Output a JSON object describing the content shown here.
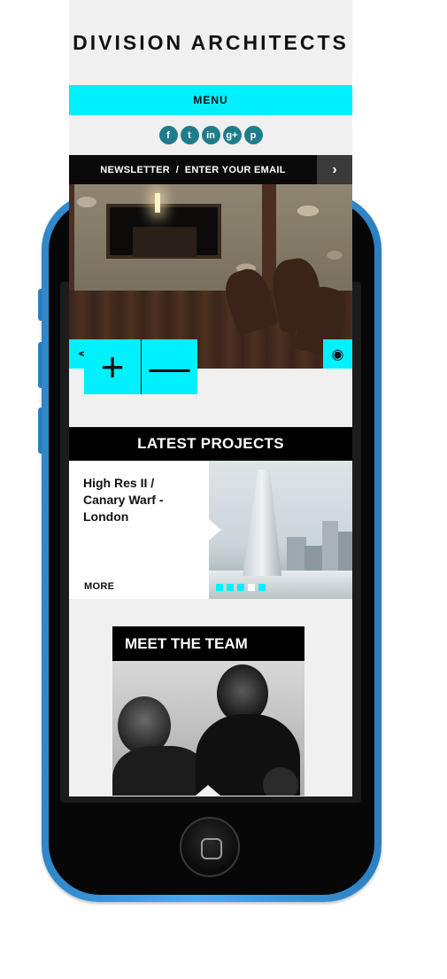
{
  "site": {
    "logo": "DIVISION ARCHITECTS",
    "menu_label": "MENU",
    "social": [
      {
        "name": "facebook",
        "glyph": "f"
      },
      {
        "name": "twitter",
        "glyph": "t"
      },
      {
        "name": "linkedin",
        "glyph": "in"
      },
      {
        "name": "google-plus",
        "glyph": "g+"
      },
      {
        "name": "pinterest",
        "glyph": "p"
      }
    ],
    "newsletter_text": "NEWSLETTER  /  ENTER YOUR EMAIL",
    "newsletter_arrow": "›",
    "hero": {
      "share_icon": "share-icon",
      "view_icon": "eye-icon",
      "zoom_in": "+",
      "zoom_out": "—"
    },
    "latest_projects": {
      "title": "LATEST PROJECTS",
      "project_name": "High Res II / Canary Warf - London",
      "more_label": "MORE",
      "slide_count": 5,
      "active_slide": 4
    },
    "team": {
      "title": "MEET THE TEAM"
    }
  },
  "colors": {
    "accent": "#00f0ff",
    "dark": "#000000",
    "background": "#f0f0f0",
    "social": "#1f7d8b",
    "phone": "#3d9ee0"
  }
}
